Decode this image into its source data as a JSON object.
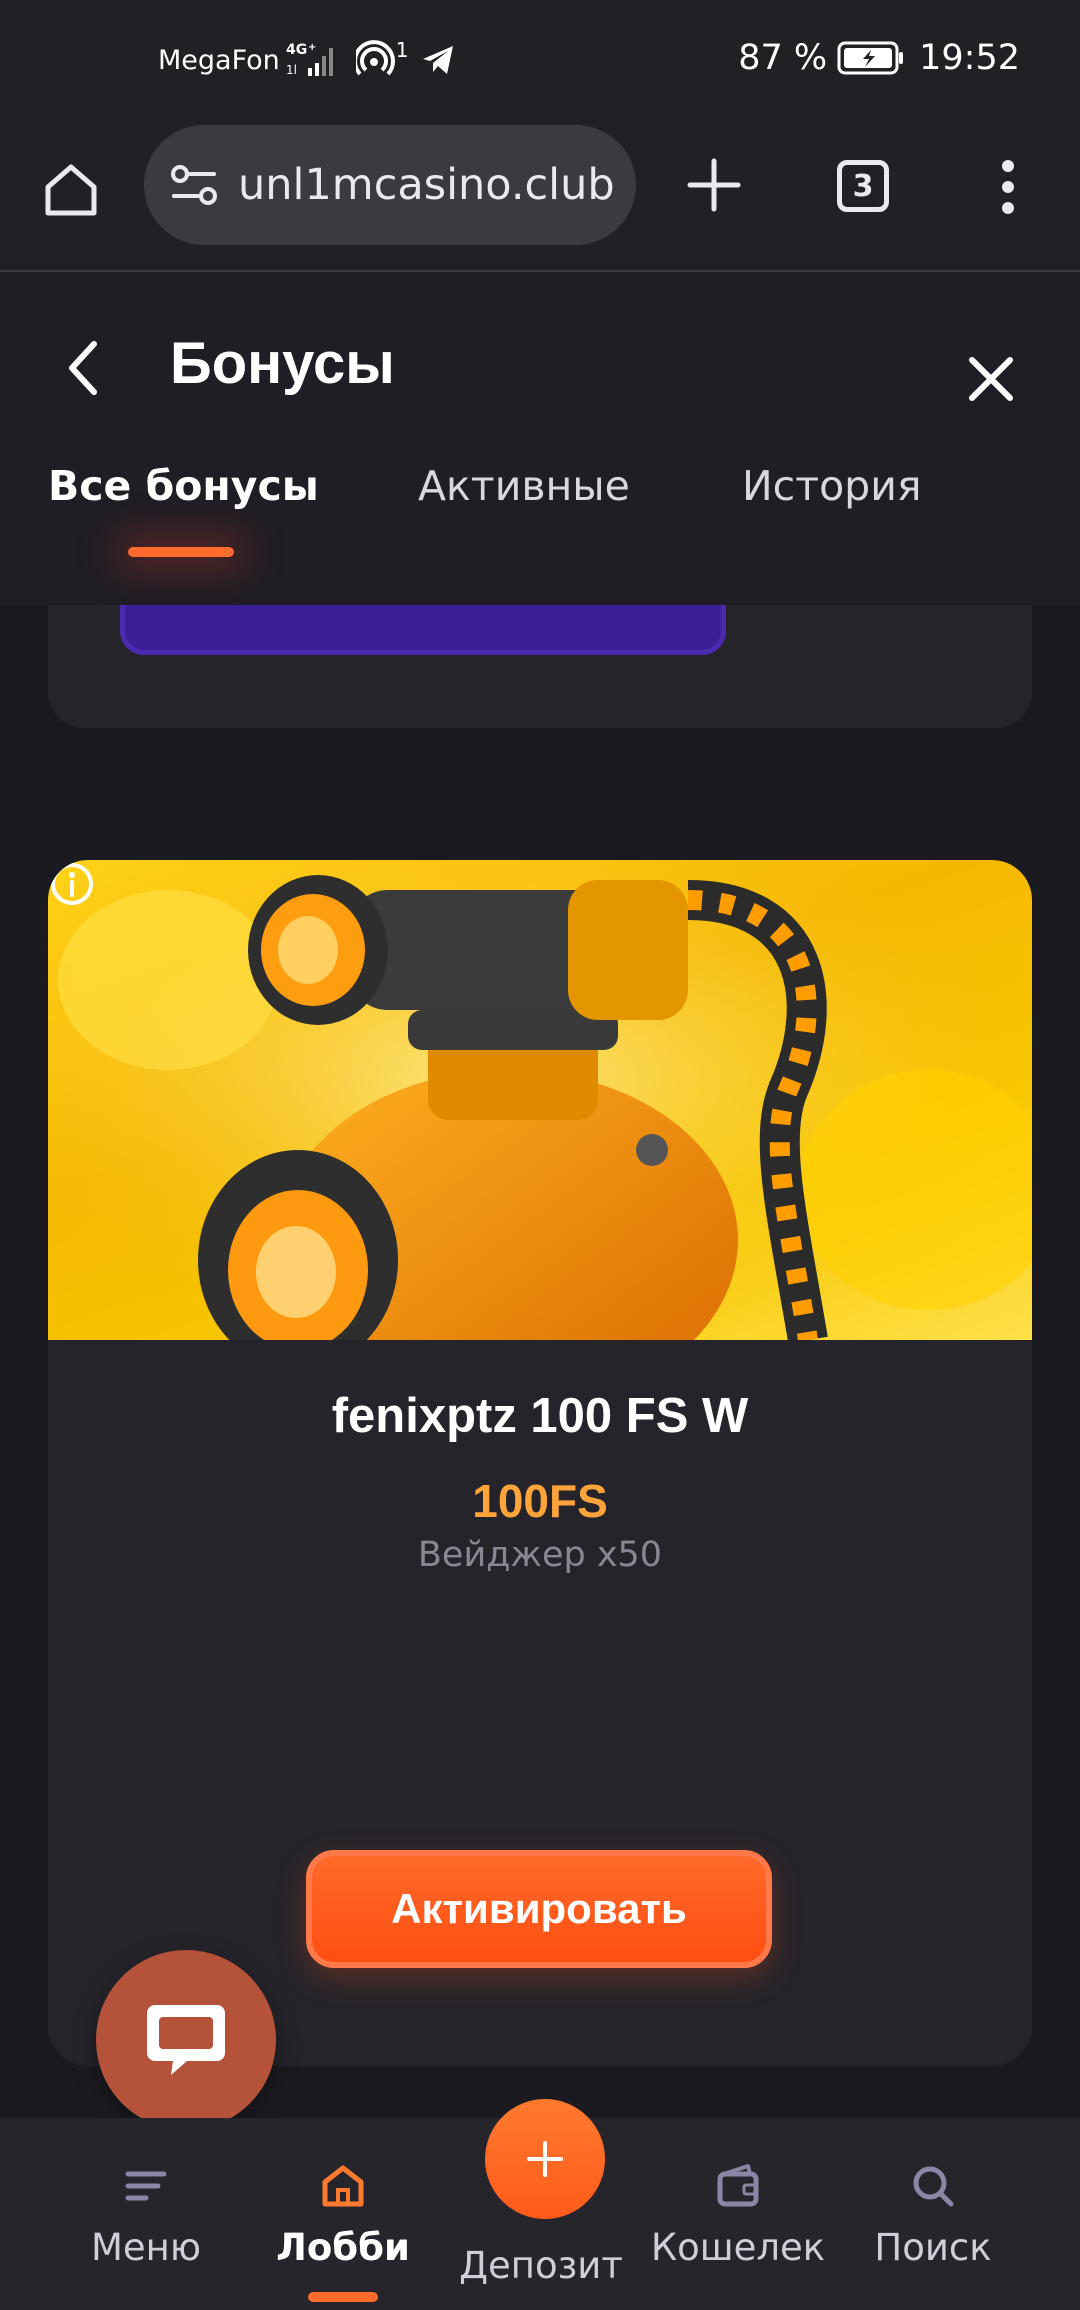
{
  "status_bar": {
    "carrier": "MegaFon",
    "network": "4G+",
    "hotspot_count": "1",
    "battery": "87 %",
    "time": "19:52"
  },
  "browser": {
    "url": "unl1mcasino.club",
    "tab_count": "3"
  },
  "header": {
    "title": "Бонусы",
    "tabs": [
      {
        "label": "Все бонусы",
        "active": true
      },
      {
        "label": "Активные",
        "active": false
      },
      {
        "label": "История",
        "active": false
      }
    ]
  },
  "bonus": {
    "name": "fenixptz 100 FS W",
    "amount": "100FS",
    "wager": "Вейджер х50",
    "activate_label": "Активировать"
  },
  "bottom_nav": {
    "items": [
      {
        "label": "Меню",
        "icon": "menu-icon",
        "active": false
      },
      {
        "label": "Лобби",
        "icon": "home-icon",
        "active": true
      },
      {
        "label": "Депозит",
        "icon": "plus-icon",
        "active": false
      },
      {
        "label": "Кошелек",
        "icon": "wallet-icon",
        "active": false
      },
      {
        "label": "Поиск",
        "icon": "search-icon",
        "active": false
      }
    ]
  },
  "colors": {
    "accent": "#ff6b2c",
    "bonus_amount": "#ffa43a",
    "background": "#1a1a20",
    "card": "#25242b",
    "chat_fab": "#b5523a"
  }
}
